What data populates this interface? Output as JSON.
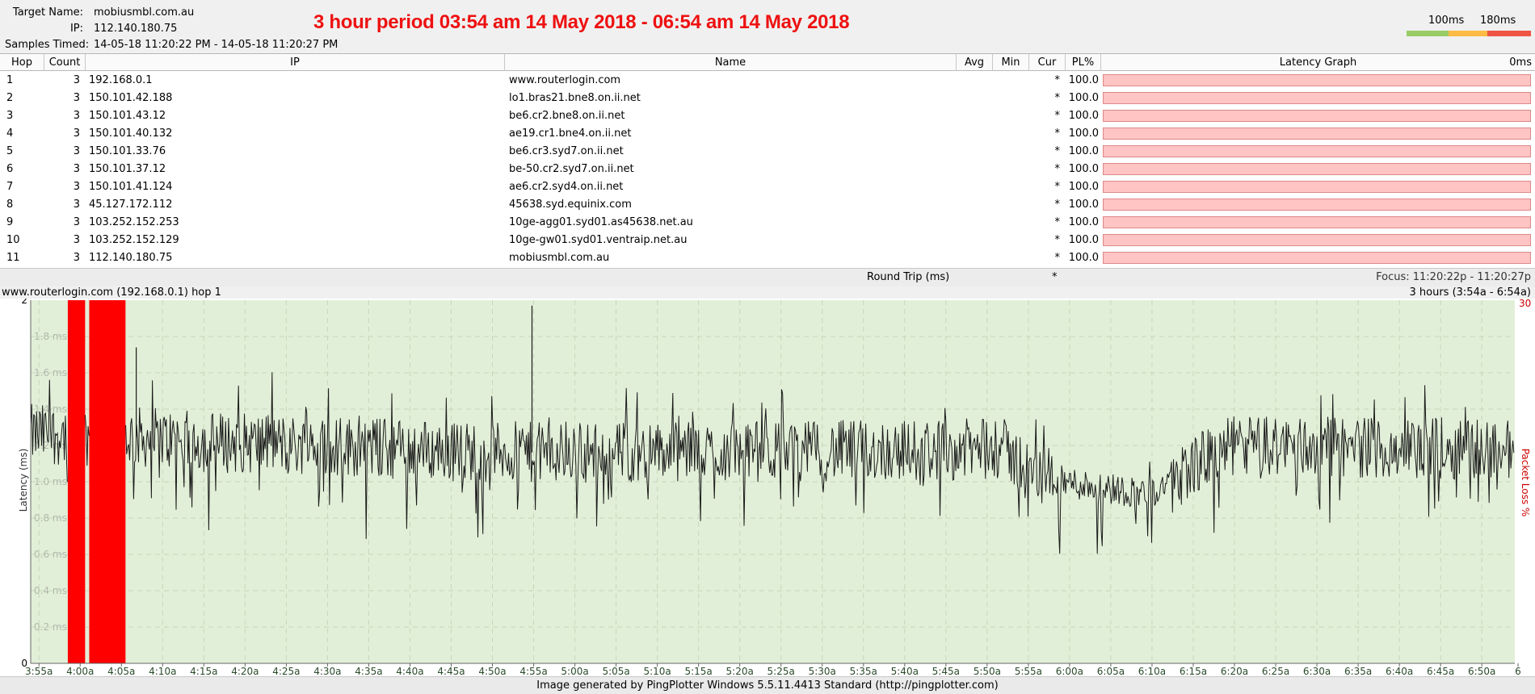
{
  "header": {
    "target_name_label": "Target Name:",
    "target_name": "mobiusmbl.com.au",
    "ip_label": "IP:",
    "ip": "112.140.180.75",
    "samples_label": "Samples Timed:",
    "samples": "14-05-18 11:20:22 PM - 14-05-18 11:20:27 PM",
    "title": "3 hour period 03:54 am 14 May 2018 - 06:54 am 14 May 2018"
  },
  "legend": {
    "label_100": "100ms",
    "label_180": "180ms",
    "colors": [
      "#99cc66",
      "#ffbb44",
      "#ee5544"
    ]
  },
  "table": {
    "columns": [
      "Hop",
      "Count",
      "IP",
      "Name",
      "Avg",
      "Min",
      "Cur",
      "PL%",
      "Latency Graph"
    ],
    "latency_graph_right": "0ms",
    "rows": [
      {
        "hop": "1",
        "count": "3",
        "ip": "192.168.0.1",
        "name": "www.routerlogin.com",
        "cur": "*",
        "pl": "100.0"
      },
      {
        "hop": "2",
        "count": "3",
        "ip": "150.101.42.188",
        "name": "lo1.bras21.bne8.on.ii.net",
        "cur": "*",
        "pl": "100.0"
      },
      {
        "hop": "3",
        "count": "3",
        "ip": "150.101.43.12",
        "name": "be6.cr2.bne8.on.ii.net",
        "cur": "*",
        "pl": "100.0"
      },
      {
        "hop": "4",
        "count": "3",
        "ip": "150.101.40.132",
        "name": "ae19.cr1.bne4.on.ii.net",
        "cur": "*",
        "pl": "100.0"
      },
      {
        "hop": "5",
        "count": "3",
        "ip": "150.101.33.76",
        "name": "be6.cr3.syd7.on.ii.net",
        "cur": "*",
        "pl": "100.0"
      },
      {
        "hop": "6",
        "count": "3",
        "ip": "150.101.37.12",
        "name": "be-50.cr2.syd7.on.ii.net",
        "cur": "*",
        "pl": "100.0"
      },
      {
        "hop": "7",
        "count": "3",
        "ip": "150.101.41.124",
        "name": "ae6.cr2.syd4.on.ii.net",
        "cur": "*",
        "pl": "100.0"
      },
      {
        "hop": "8",
        "count": "3",
        "ip": "45.127.172.112",
        "name": "45638.syd.equinix.com",
        "cur": "*",
        "pl": "100.0"
      },
      {
        "hop": "9",
        "count": "3",
        "ip": "103.252.152.253",
        "name": "10ge-agg01.syd01.as45638.net.au",
        "cur": "*",
        "pl": "100.0"
      },
      {
        "hop": "10",
        "count": "3",
        "ip": "103.252.152.129",
        "name": "10ge-gw01.syd01.ventraip.net.au",
        "cur": "*",
        "pl": "100.0"
      },
      {
        "hop": "11",
        "count": "3",
        "ip": "112.140.180.75",
        "name": "mobiusmbl.com.au",
        "cur": "*",
        "pl": "100.0"
      }
    ],
    "round_trip_label": "Round Trip (ms)",
    "round_trip_cur": "*",
    "focus": "Focus: 11:20:22p - 11:20:27p"
  },
  "graph_header": {
    "left": "www.routerlogin.com (192.168.0.1) hop 1",
    "right": "3 hours (3:54a - 6:54a)"
  },
  "chart_data": {
    "type": "line",
    "ylabel": "Latency (ms)",
    "y2label": "Packet Loss %",
    "y2_max_label": "30",
    "ylim": [
      0,
      2
    ],
    "y_ticks": [
      {
        "v": 2,
        "label": "2"
      },
      {
        "v": 1.8,
        "label": "1.8 ms"
      },
      {
        "v": 1.6,
        "label": "1.6 ms"
      },
      {
        "v": 1.4,
        "label": "1.4 ms"
      },
      {
        "v": 1.2,
        "label": "1.2 ms"
      },
      {
        "v": 1.0,
        "label": "1.0 ms"
      },
      {
        "v": 0.8,
        "label": "0.8 ms"
      },
      {
        "v": 0.6,
        "label": "0.6 ms"
      },
      {
        "v": 0.4,
        "label": "0.4 ms"
      },
      {
        "v": 0.2,
        "label": "0.2 ms"
      },
      {
        "v": 0,
        "label": "0"
      }
    ],
    "x_ticks": [
      "3:55a",
      "4:00a",
      "4:05a",
      "4:10a",
      "4:15a",
      "4:20a",
      "4:25a",
      "4:30a",
      "4:35a",
      "4:40a",
      "4:45a",
      "4:50a",
      "4:55a",
      "5:00a",
      "5:05a",
      "5:10a",
      "5:15a",
      "5:20a",
      "5:25a",
      "5:30a",
      "5:35a",
      "5:40a",
      "5:45a",
      "5:50a",
      "5:55a",
      "6:00a",
      "6:05a",
      "6:10a",
      "6:15a",
      "6:20a",
      "6:25a",
      "6:30a",
      "6:35a",
      "6:40a",
      "6:45a",
      "6:50a",
      "6"
    ],
    "xlim_minutes": [
      234,
      414
    ],
    "first_tick_minutes": 235,
    "tick_step_minutes": 5,
    "packet_loss_spans": [
      [
        238.5,
        240.6
      ],
      [
        241.1,
        245.5
      ]
    ],
    "latency_profile": [
      {
        "t": 234,
        "v": 1.26
      },
      {
        "t": 238.5,
        "v": 1.26
      },
      {
        "t": 245.5,
        "v": 1.25
      },
      {
        "t": 255,
        "v": 1.22
      },
      {
        "t": 270,
        "v": 1.2
      },
      {
        "t": 285,
        "v": 1.17
      },
      {
        "t": 297,
        "v": 1.16
      },
      {
        "t": 330,
        "v": 1.17
      },
      {
        "t": 352,
        "v": 1.18
      },
      {
        "t": 356,
        "v": 1.02
      },
      {
        "t": 370,
        "v": 0.93
      },
      {
        "t": 373,
        "v": 1.05
      },
      {
        "t": 380,
        "v": 1.2
      },
      {
        "t": 414,
        "v": 1.18
      }
    ],
    "spikes": [
      {
        "t": 246.8,
        "v": 1.74
      },
      {
        "t": 294.8,
        "v": 1.97
      }
    ],
    "series": [
      {
        "values_note": "dense sampled latency ~1.1-1.3 ms with 0.75-1.5 ms variance"
      }
    ]
  },
  "colors": {
    "title_red": "#ee1111",
    "graph_bg": "#e2efd8",
    "loss_red": "#ff0000",
    "latency_bar": "#ffc4c4",
    "line": "#1a1a1a",
    "y2_red": "#cc0000"
  },
  "footer": {
    "credit": "Image generated by PingPlotter Windows 5.5.11.4413 Standard (http://pingplotter.com)"
  }
}
